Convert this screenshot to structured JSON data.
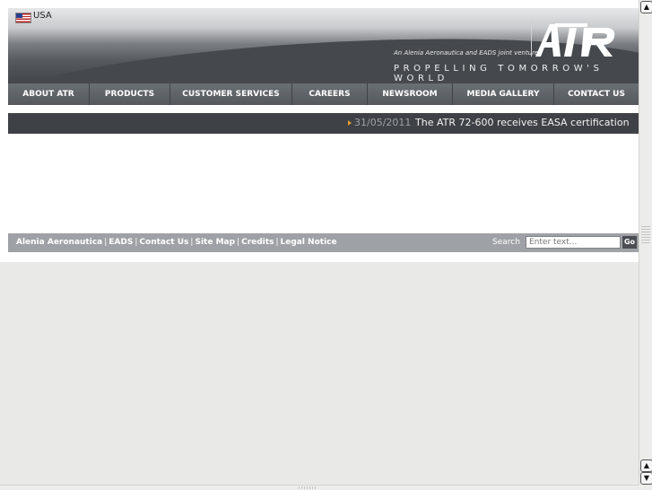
{
  "header": {
    "country": "USA",
    "flag_icon": "us-flag-icon",
    "tagline": "An Alenia Aeronautica and EADS joint venture",
    "logo_text": "ATR",
    "slogan": "PROPELLING TOMORROW'S WORLD"
  },
  "nav": {
    "items": [
      {
        "label": "ABOUT ATR"
      },
      {
        "label": "PRODUCTS"
      },
      {
        "label": "CUSTOMER SERVICES"
      },
      {
        "label": "CAREERS"
      },
      {
        "label": "NEWSROOM"
      },
      {
        "label": "MEDIA GALLERY"
      },
      {
        "label": "CONTACT US"
      }
    ]
  },
  "ticker": {
    "date": "31/05/2011",
    "text": "The ATR 72-600 receives EASA certification"
  },
  "footer": {
    "links": [
      {
        "label": "Alenia Aeronautica"
      },
      {
        "label": "EADS"
      },
      {
        "label": "Contact Us"
      },
      {
        "label": "Site Map"
      },
      {
        "label": "Credits"
      },
      {
        "label": "Legal Notice"
      }
    ],
    "separator": "|",
    "search_label": "Search",
    "search_placeholder": "Enter text...",
    "go_label": "Go"
  },
  "colors": {
    "header_dark": "#43474b",
    "nav_bg": "#5b6065",
    "ticker_bg": "#3e4246",
    "ticker_arrow": "#e29a2a",
    "footer_bg": "#9ea2a6",
    "page_bg": "#e9e9e7"
  }
}
